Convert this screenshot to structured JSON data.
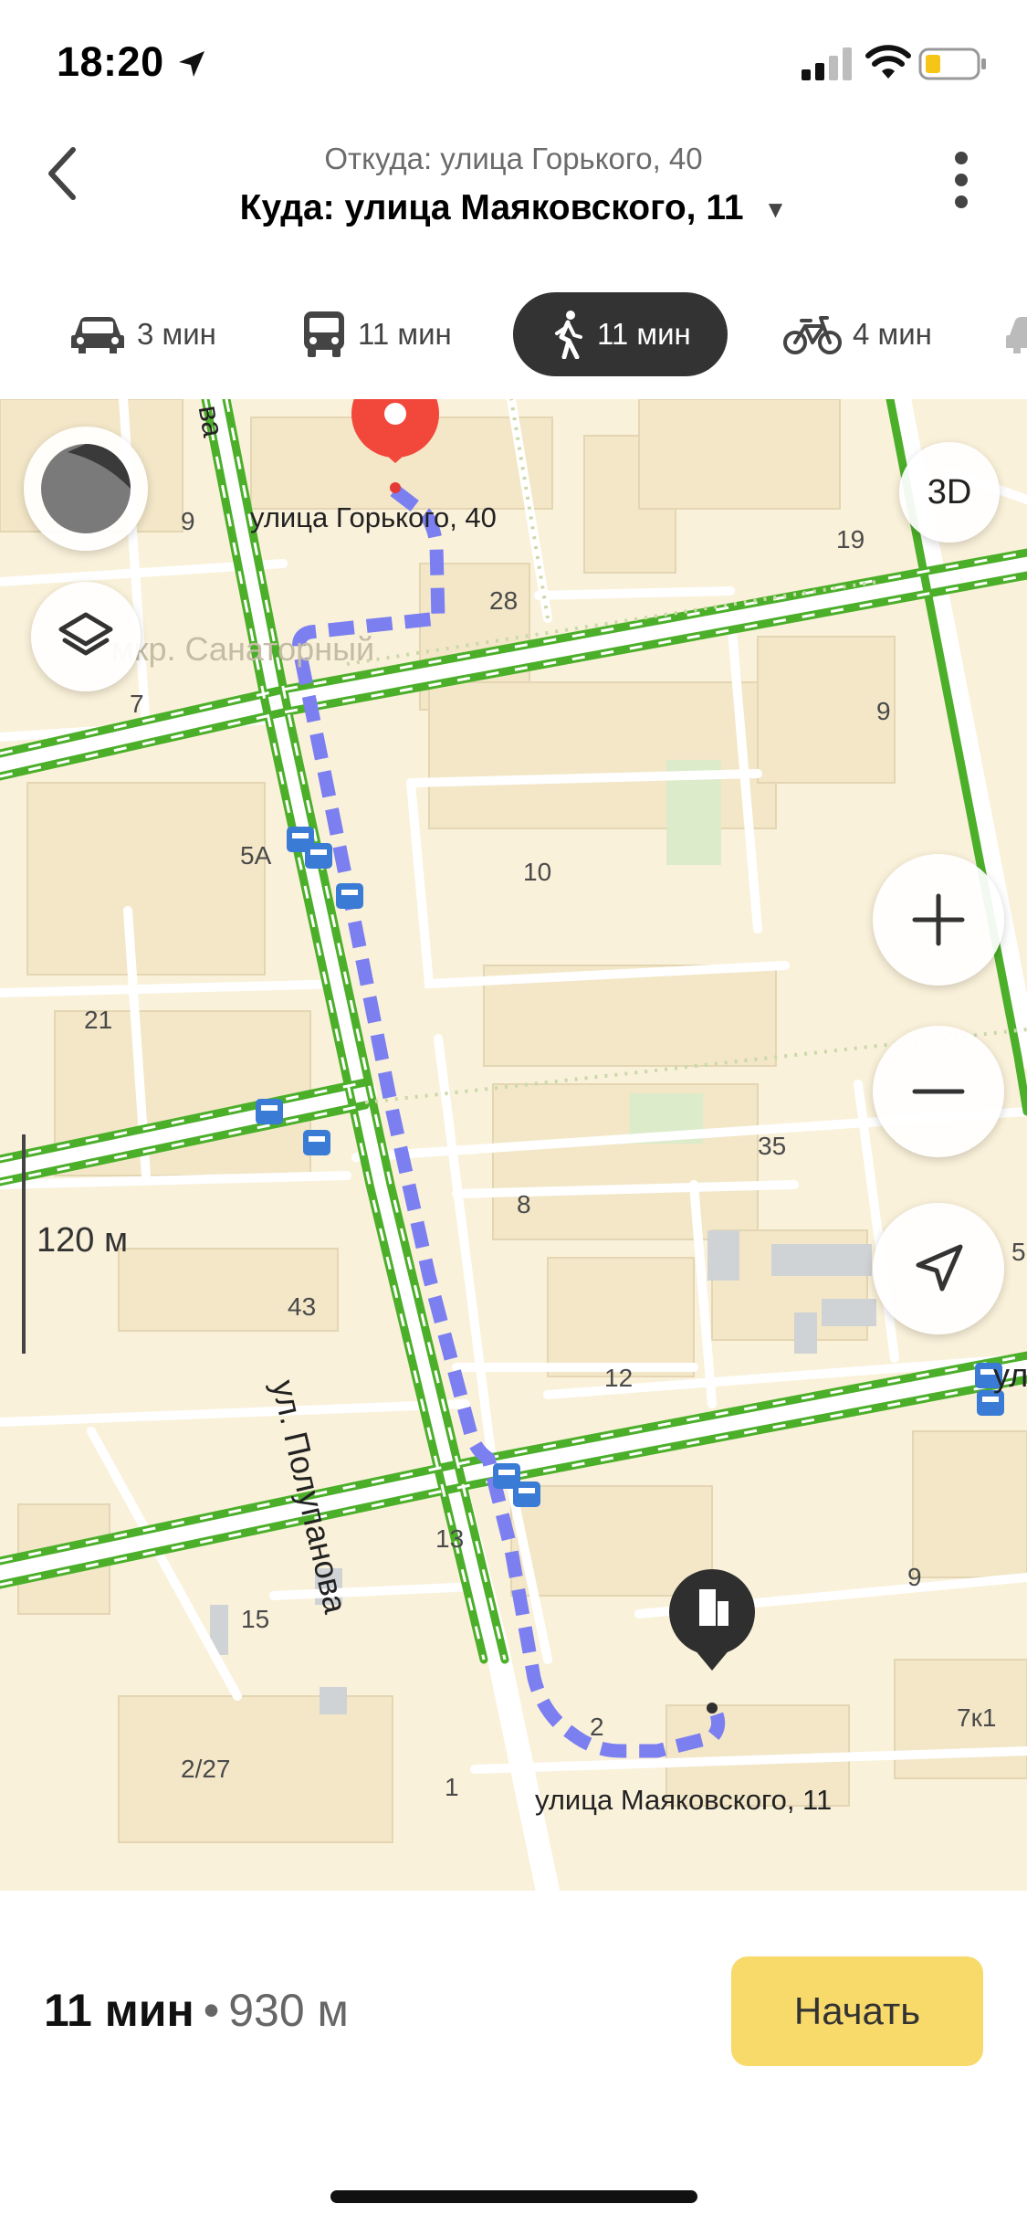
{
  "status_bar": {
    "time": "18:20"
  },
  "header": {
    "from": "Откуда: улица Горького, 40",
    "to": "Куда: улица Маяковского, 11"
  },
  "modes": [
    {
      "icon": "car-icon",
      "label": "3 мин"
    },
    {
      "icon": "bus-icon",
      "label": "11 мин"
    },
    {
      "icon": "walk-icon",
      "label": "11 мин",
      "active": true
    },
    {
      "icon": "bike-icon",
      "label": "4 мин"
    }
  ],
  "map": {
    "start_label": "улица Горького, 40",
    "end_label": "улица Маяковского, 11",
    "district_label": "мкр. Санаторный",
    "street_label": "ул. Полупанова",
    "street_label_partial": "ул",
    "street_label_partial_left": "ва",
    "scale_label": "120 м",
    "button_3d": "3D",
    "house_numbers": [
      "9",
      "28",
      "19",
      "7",
      "9",
      "5А",
      "10",
      "21",
      "35",
      "8",
      "43",
      "12",
      "13",
      "9",
      "15",
      "2",
      "7к1",
      "2/27",
      "1",
      "5"
    ],
    "route_color": "#7b7ff0",
    "road_color": "#4caf2a"
  },
  "summary": {
    "time": "11 мин",
    "separator": "•",
    "distance": "930 м"
  },
  "start_button": "Начать"
}
